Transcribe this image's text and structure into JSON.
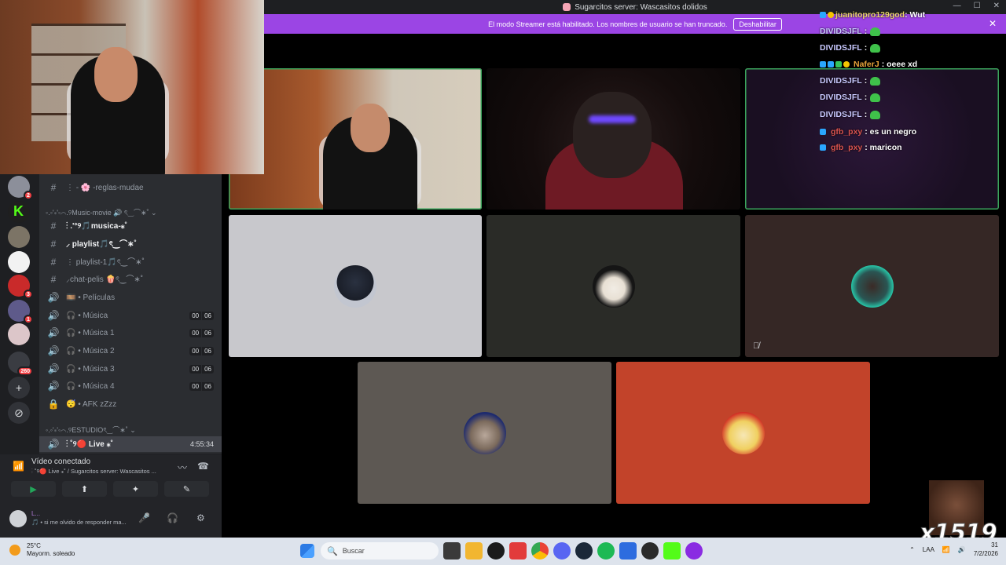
{
  "window": {
    "title": "Sugarcitos server: Wascasitos dolidos",
    "controls": [
      "—",
      "☐",
      "✕"
    ]
  },
  "banner": {
    "text": "El modo Streamer está habilitado. Los nombres de usuario se han truncado.",
    "button": "Deshabilitar",
    "close": "✕"
  },
  "server_rail": {
    "badges": [
      "2",
      "3",
      "1",
      "260"
    ],
    "add": "+",
    "explore": "⊘"
  },
  "channels": {
    "category_music": "◦.◦'∗'◦⌒.୨Music-movie 🔊 ৎ‿⌒∗˚ ⌄",
    "category_studio": "◦.◦'∗'◦⌒.୨ESTUDIOৎ‿⌒∗˚ ⌄",
    "items": [
      {
        "icon": "#",
        "label": "⋮ - 🌸 -reglas-mudae",
        "active": false
      },
      {
        "icon": "#",
        "label": "⋮ .'°୨🎵musica-⁎˚",
        "active": true
      },
      {
        "icon": "#",
        "label": "⸝ playlist🎵ৎ‿⌒∗˚",
        "active": true
      },
      {
        "icon": "#",
        "label": "⋮ playlist-1🎵ৎ‿⌒∗˚",
        "active": false
      },
      {
        "icon": "#",
        "label": "⸝chat-pelis 🍿ৎ‿⌒∗˚",
        "active": false
      },
      {
        "icon": "🔊",
        "label": "🎞️ • Películas",
        "active": false
      },
      {
        "icon": "🔊",
        "label": "🎧 • Música",
        "active": false,
        "count": [
          "00",
          "06"
        ]
      },
      {
        "icon": "🔊",
        "label": "🎧 • Música 1",
        "active": false,
        "count": [
          "00",
          "06"
        ]
      },
      {
        "icon": "🔊",
        "label": "🎧 • Música 2",
        "active": false,
        "count": [
          "00",
          "06"
        ]
      },
      {
        "icon": "🔊",
        "label": "🎧 • Música 3",
        "active": false,
        "count": [
          "00",
          "06"
        ]
      },
      {
        "icon": "🔊",
        "label": "🎧 • Música 4",
        "active": false,
        "count": [
          "00",
          "06"
        ]
      },
      {
        "icon": "🔒",
        "label": "😴 • AFK zZzz",
        "active": false
      }
    ],
    "live": {
      "icon": "🔊",
      "label": "⋮ ˚୨🔴 Live ⁎˚",
      "time": "4:55:34"
    }
  },
  "voice_panel": {
    "title": "Vídeo conectado",
    "subtitle": "⋮ ˚୨🔴 Live ⁎˚ / Sugarcitos server: Wascasitos ...",
    "buttons": [
      "▶",
      "⬆",
      "✦",
      "✎"
    ]
  },
  "user_panel": {
    "name": "L...",
    "status": "🎵 • si me olvido de responder ma..."
  },
  "chat": [
    {
      "badges": [
        "b",
        "y"
      ],
      "name": "juanitopro129god",
      "text": ": Wut"
    },
    {
      "badges": [],
      "name": "DIVIDSJFL",
      "text": ":",
      "emote": true
    },
    {
      "badges": [],
      "name": "DIVIDSJFL",
      "text": ":",
      "emote": true
    },
    {
      "badges": [
        "b",
        "b",
        "g",
        "y"
      ],
      "name": "NaferJ",
      "text": ": oeee xd"
    },
    {
      "badges": [],
      "name": "DIVIDSJFL",
      "text": ":",
      "emote": true
    },
    {
      "badges": [],
      "name": "DIVIDSJFL",
      "text": ":",
      "emote": true
    },
    {
      "badges": [],
      "name": "DIVIDSJFL",
      "text": ":",
      "emote": true
    },
    {
      "badges": [
        "b"
      ],
      "name": "gfb_pxy",
      "text": ": es un negro"
    },
    {
      "badges": [
        "b"
      ],
      "name": "gfb_pxy",
      "text": ": maricon"
    }
  ],
  "overlay": {
    "xtext": "x1519"
  },
  "taskbar": {
    "temp": "25°C",
    "weather": "Mayorm. soleado",
    "search_placeholder": "Buscar",
    "lang": "LAA",
    "time": "31",
    "date": "7/2/2026"
  },
  "colors": {
    "banner": "#9b45e4",
    "speaking": "#3ba55c",
    "tile_gray": "#c8c8cc",
    "tile_dark": "#2a2b27",
    "tile_brown": "#352725",
    "tile_taupe": "#5d5853",
    "tile_orange": "#c2432a"
  }
}
